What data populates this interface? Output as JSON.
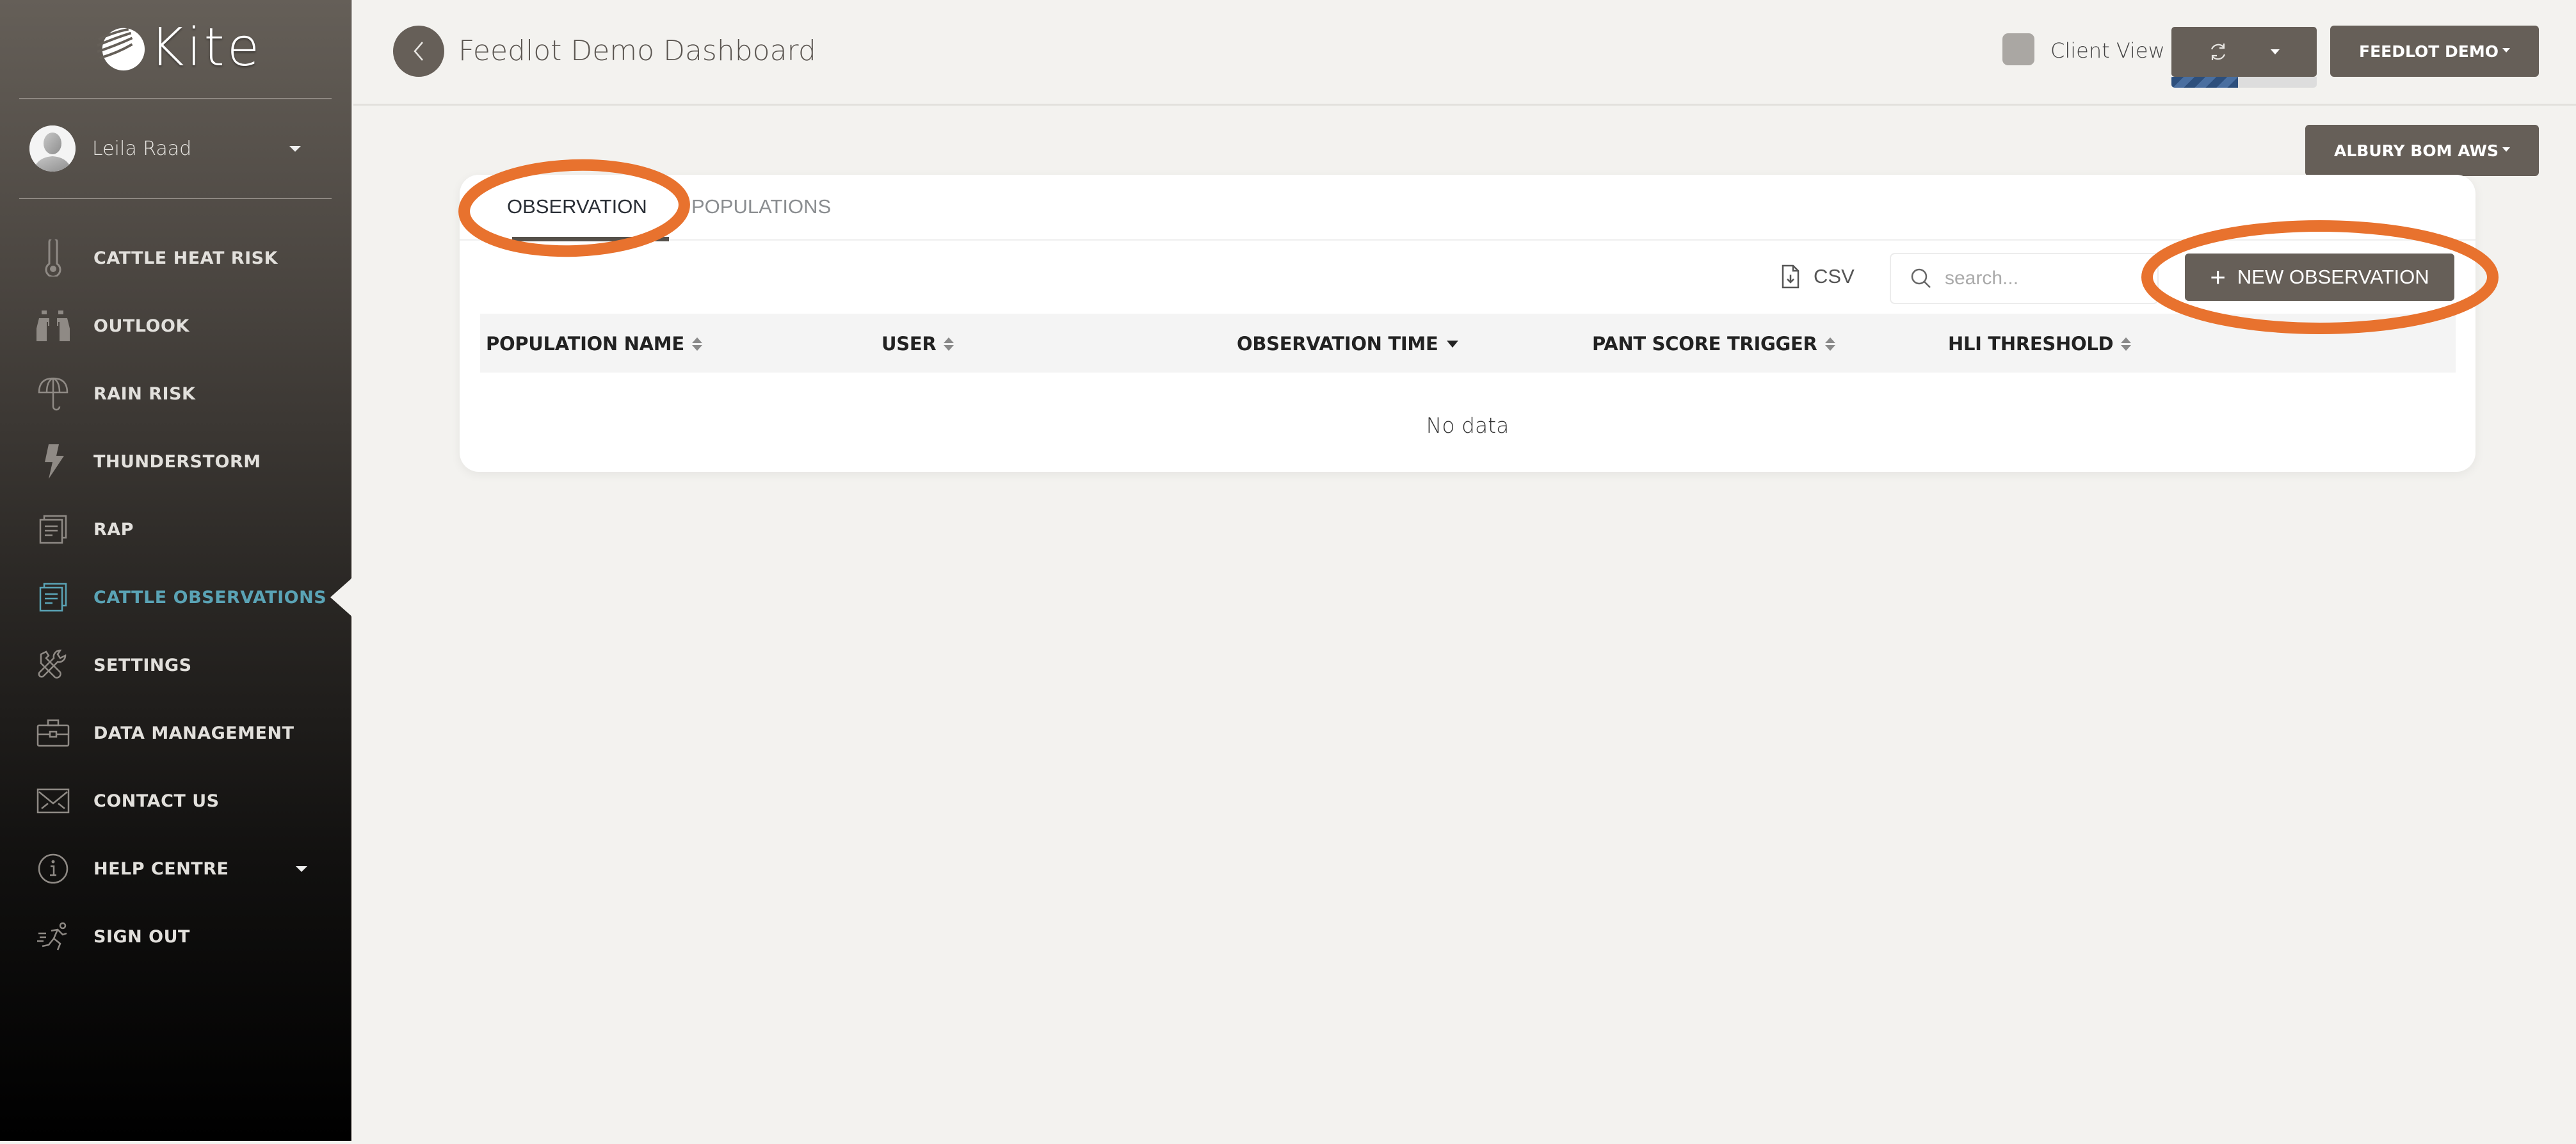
{
  "app": {
    "name": "Kite"
  },
  "user": {
    "name": "Leila Raad"
  },
  "sidebar": {
    "items": [
      {
        "label": "CATTLE HEAT RISK",
        "icon": "thermometer-icon"
      },
      {
        "label": "OUTLOOK",
        "icon": "binoculars-icon"
      },
      {
        "label": "RAIN RISK",
        "icon": "umbrella-icon"
      },
      {
        "label": "THUNDERSTORM",
        "icon": "lightning-icon"
      },
      {
        "label": "RAP",
        "icon": "document-stack-icon"
      },
      {
        "label": "CATTLE OBSERVATIONS",
        "icon": "document-stack-icon",
        "active": true
      },
      {
        "label": "SETTINGS",
        "icon": "tools-icon"
      },
      {
        "label": "DATA MANAGEMENT",
        "icon": "briefcase-icon"
      },
      {
        "label": "CONTACT US",
        "icon": "envelope-icon"
      },
      {
        "label": "HELP CENTRE",
        "icon": "info-icon",
        "has_dropdown": true
      },
      {
        "label": "SIGN OUT",
        "icon": "running-person-icon"
      }
    ],
    "active_color": "#5aa3b5"
  },
  "header": {
    "title": "Feedlot Demo Dashboard",
    "client_view_label": "Client View",
    "refresh_progress_percent": 46,
    "account_button": "FEEDLOT DEMO",
    "station_button": "ALBURY BOM AWS"
  },
  "tabs": [
    {
      "label": "OBSERVATION",
      "active": true
    },
    {
      "label": "POPULATIONS",
      "active": false
    }
  ],
  "toolbar": {
    "csv_label": "CSV",
    "search_placeholder": "search...",
    "search_value": "",
    "new_button": "NEW OBSERVATION"
  },
  "table": {
    "columns": [
      {
        "label": "POPULATION NAME",
        "sort": "none"
      },
      {
        "label": "USER",
        "sort": "none"
      },
      {
        "label": "OBSERVATION TIME",
        "sort": "desc"
      },
      {
        "label": "PANT SCORE TRIGGER",
        "sort": "none"
      },
      {
        "label": "HLI THRESHOLD",
        "sort": "none"
      }
    ],
    "rows": [],
    "empty_text": "No data"
  },
  "colors": {
    "primary_button": "#665f58",
    "annotation": "#e8722e",
    "progress": "#2d4f7c"
  }
}
